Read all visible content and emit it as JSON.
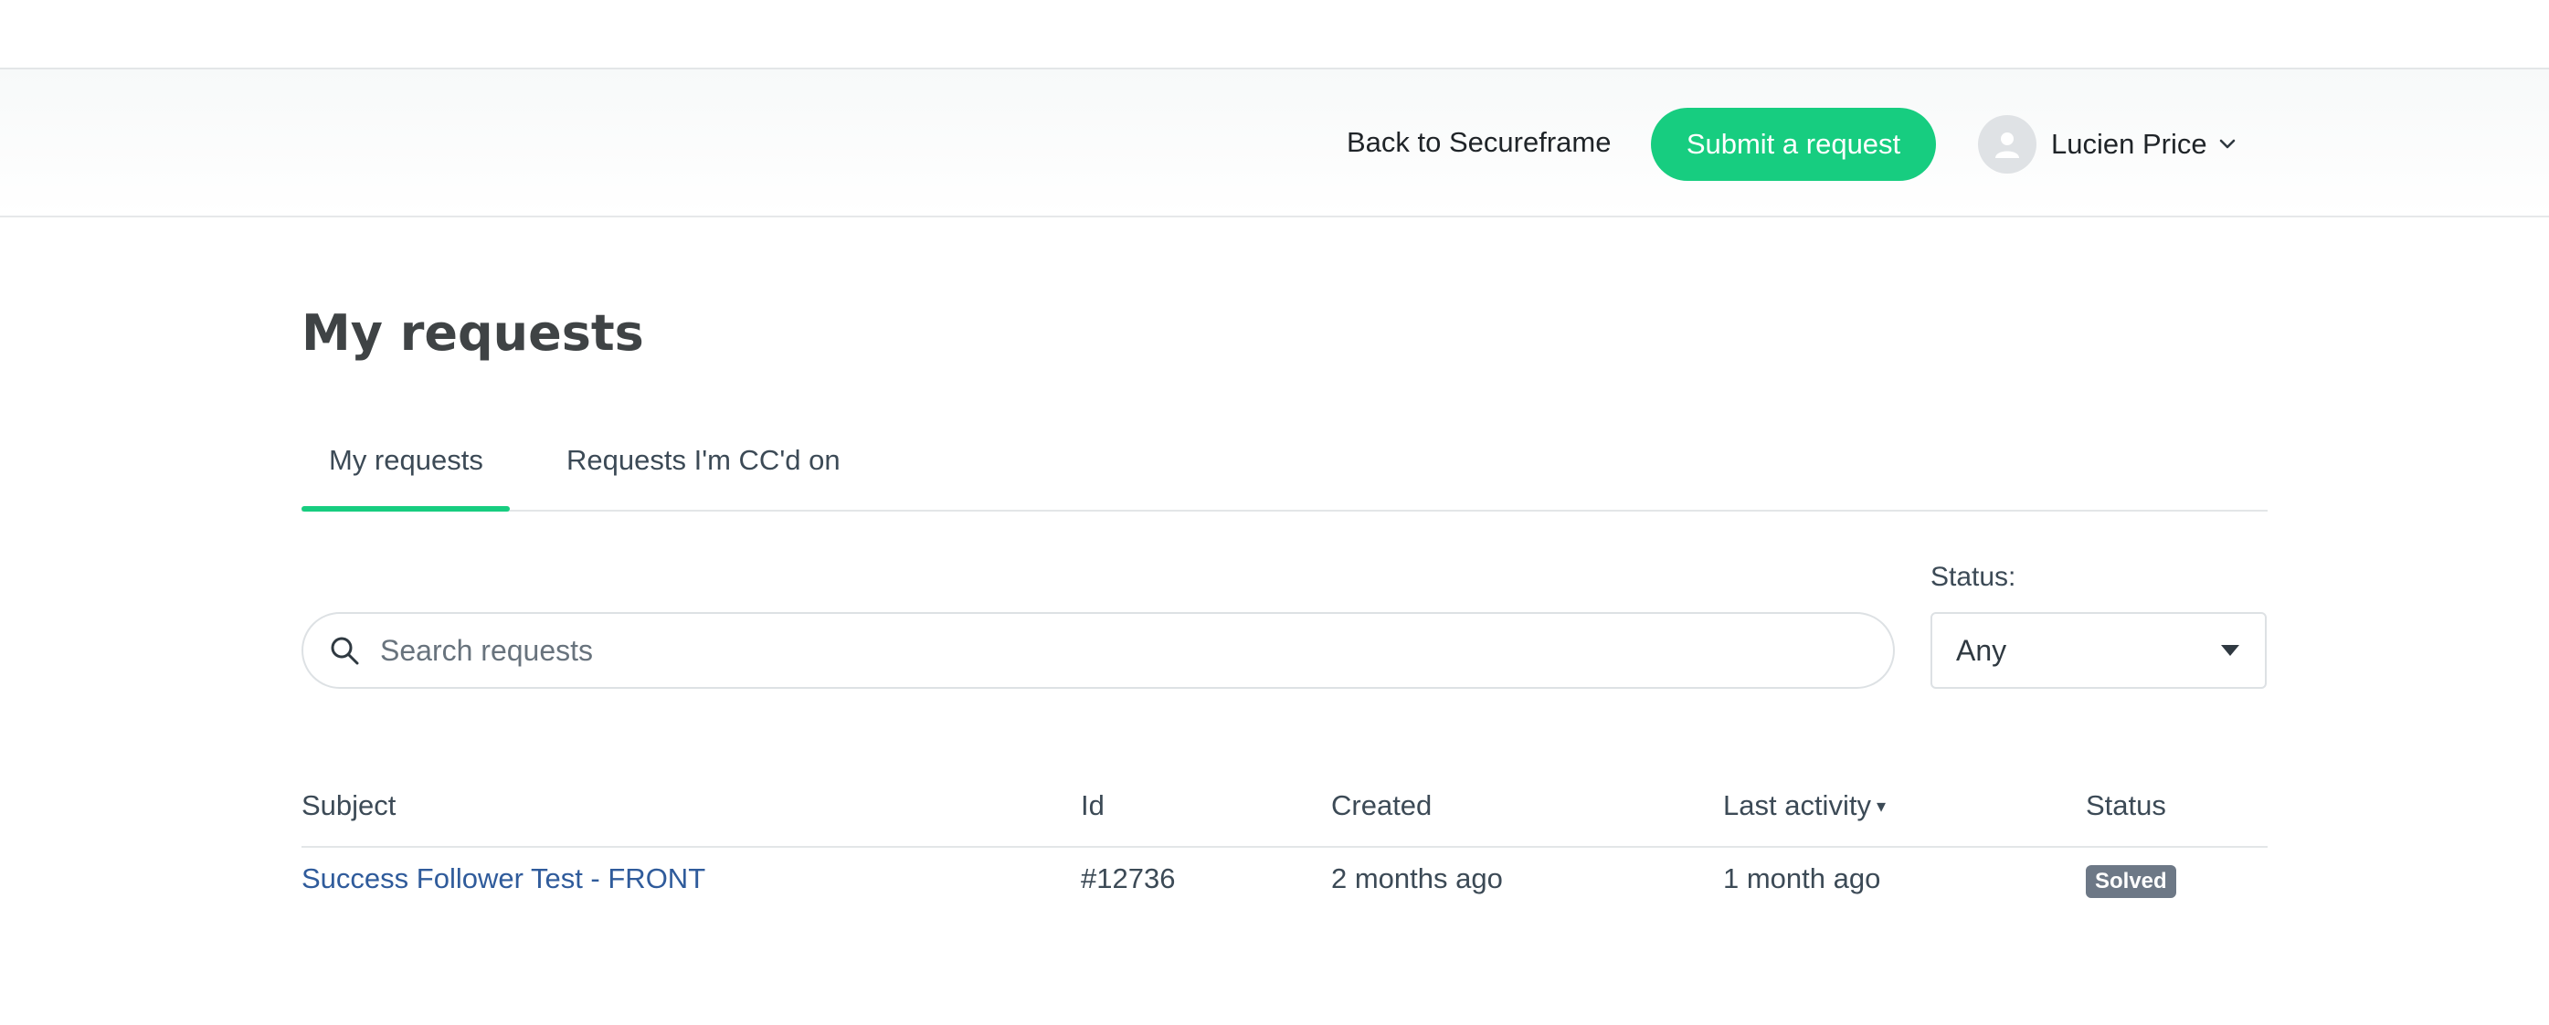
{
  "header": {
    "back_link": "Back to Secureframe",
    "submit_button": "Submit a request",
    "user_name": "Lucien Price"
  },
  "page": {
    "title": "My requests"
  },
  "tabs": [
    {
      "label": "My requests",
      "active": true
    },
    {
      "label": "Requests I'm CC'd on",
      "active": false
    }
  ],
  "filters": {
    "search_placeholder": "Search requests",
    "status_label": "Status:",
    "status_selected": "Any"
  },
  "table": {
    "columns": [
      "Subject",
      "Id",
      "Created",
      "Last activity",
      "Status"
    ],
    "sort_indicator": "▾",
    "rows": [
      {
        "subject": "Success Follower Test - FRONT",
        "id": "#12736",
        "created": "2 months ago",
        "last_activity": "1 month ago",
        "status": "Solved"
      }
    ]
  },
  "icons": {
    "search": "search-icon",
    "avatar": "user-avatar-icon",
    "chevron": "chevron-down-icon",
    "select_caret": "caret-down-icon"
  },
  "colors": {
    "accent": "#17cd80",
    "link": "#2f5b9b",
    "badge": "#6d7886"
  }
}
